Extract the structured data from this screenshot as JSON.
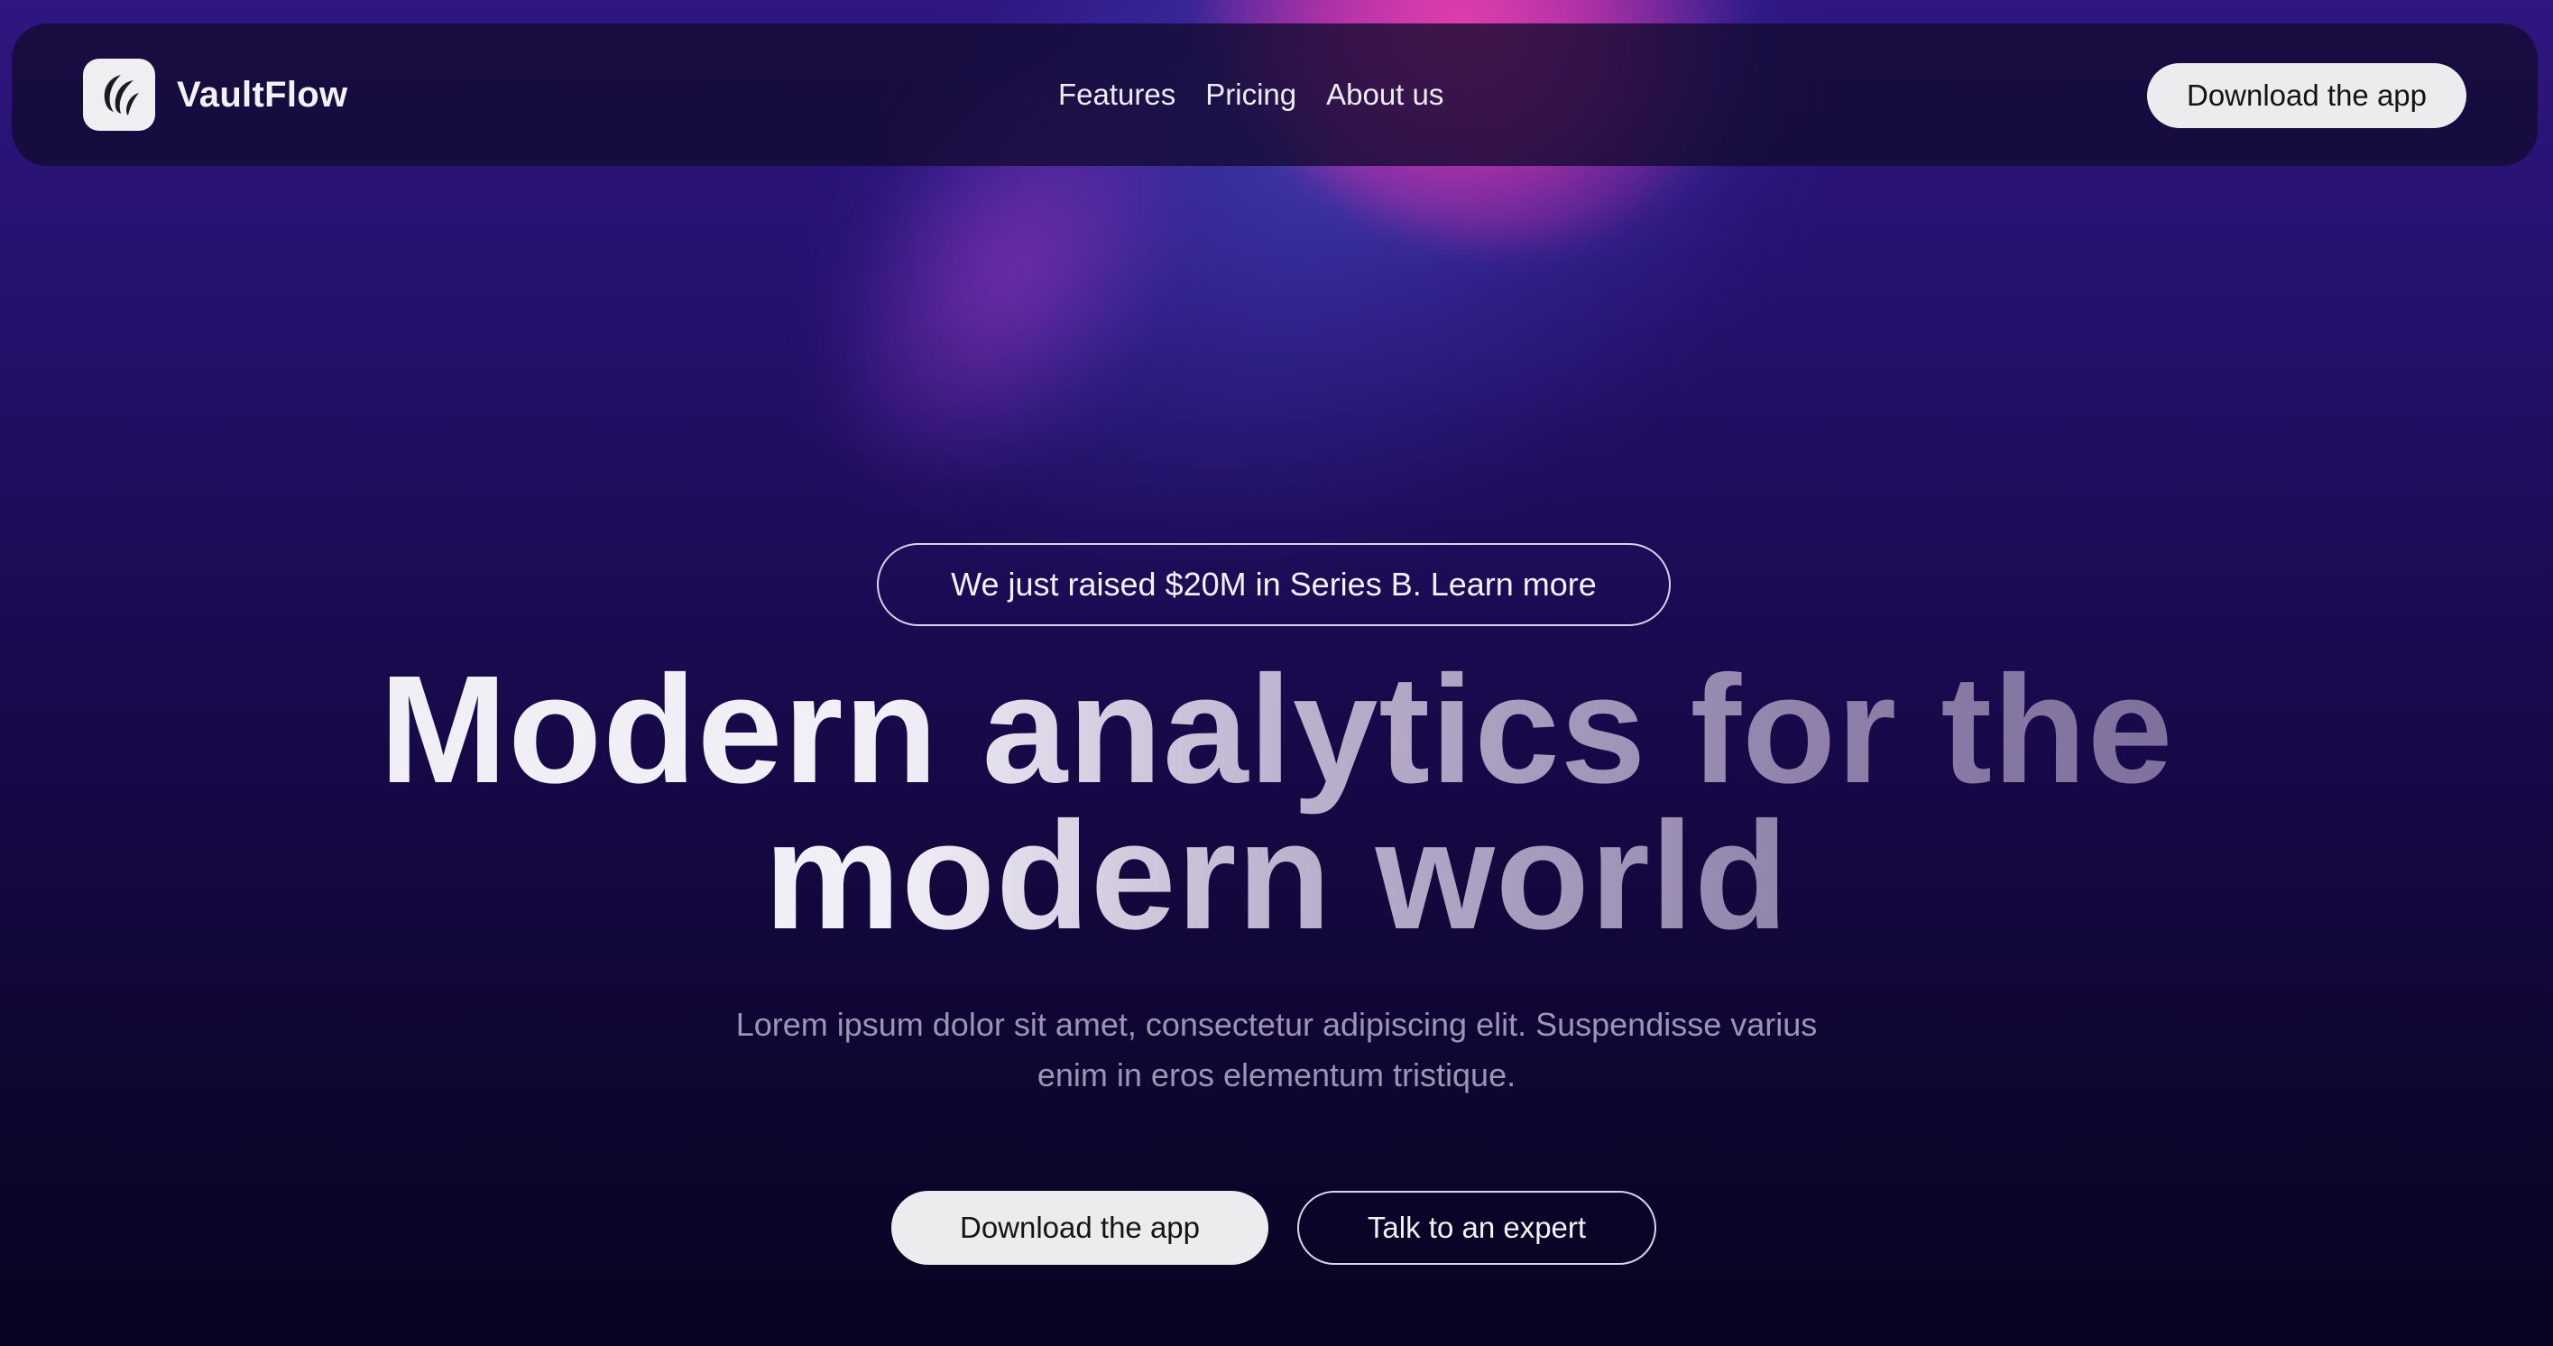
{
  "navbar": {
    "brand_name": "VaultFlow",
    "logo_icon": "vaultflow-logo-icon",
    "links": [
      "Features",
      "Pricing",
      "About us"
    ],
    "cta_label": "Download the app"
  },
  "hero": {
    "announcement": "We just raised $20M in Series B. Learn more",
    "headline_line1": "Modern analytics for the",
    "headline_line2": "modern world",
    "subtext_line1": "Lorem ipsum dolor sit amet, consectetur adipiscing elit. Suspendisse varius",
    "subtext_line2": "enim in eros elementum tristique.",
    "primary_button": "Download the app",
    "secondary_button": "Talk to an expert"
  },
  "colors": {
    "background_top": "#2f1680",
    "background_bottom": "#090320",
    "glow_pink": "#ec40ac",
    "button_light": "#ececee"
  }
}
